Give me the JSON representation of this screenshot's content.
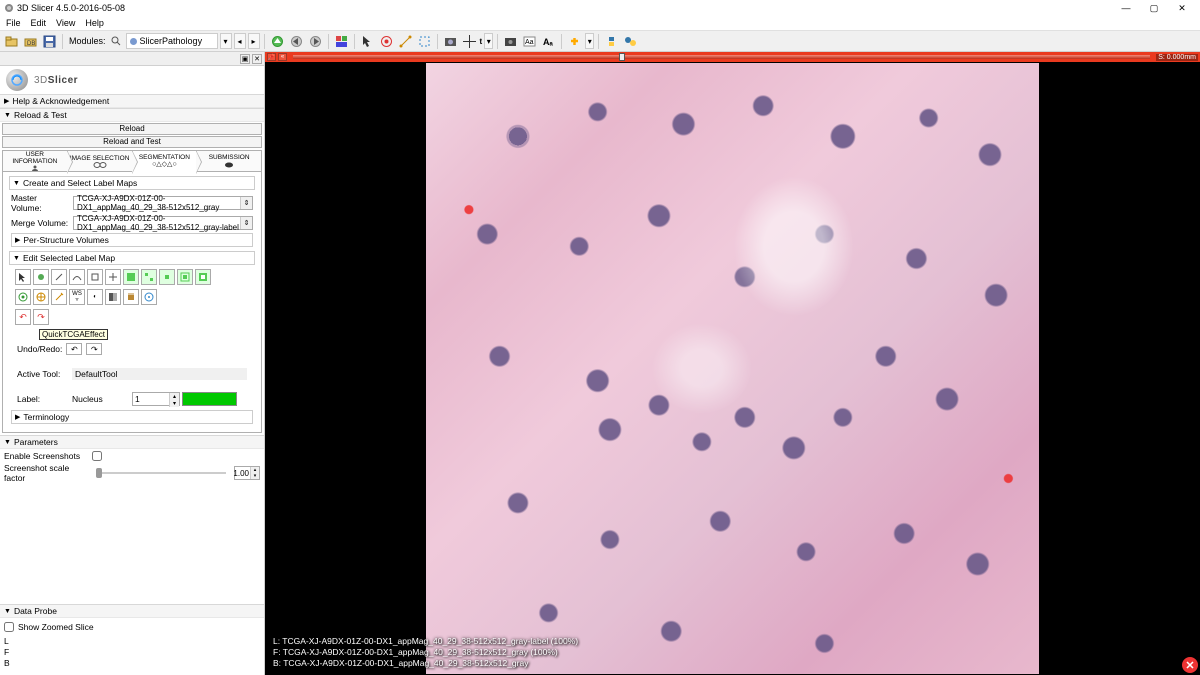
{
  "window": {
    "title": "3D Slicer 4.5.0-2016-05-08"
  },
  "menu": {
    "items": [
      "File",
      "Edit",
      "View",
      "Help"
    ]
  },
  "modules": {
    "label": "Modules:",
    "current": "SlicerPathology"
  },
  "logo": {
    "prefix": "3D",
    "suffix": "Slicer"
  },
  "sections": {
    "help": "Help & Acknowledgement",
    "reload": "Reload & Test",
    "reload_btn": "Reload",
    "reload_test_btn": "Reload and Test"
  },
  "tabs": {
    "items": [
      "USER INFORMATION",
      "IMAGE SELECTION",
      "SEGMENTATION",
      "SUBMISSION"
    ],
    "active": 2
  },
  "createSelect": {
    "title": "Create and Select Label Maps",
    "master_label": "Master Volume:",
    "master_value": "TCGA-XJ-A9DX-01Z-00-DX1_appMag_40_29_38-512x512_gray",
    "merge_label": "Merge Volume:",
    "merge_value": "TCGA-XJ-A9DX-01Z-00-DX1_appMag_40_29_38-512x512_gray-label",
    "per_structure": "Per-Structure Volumes"
  },
  "editMap": {
    "title": "Edit Selected Label Map",
    "tooltip": "QuickTCGAEffect",
    "undo_label": "Undo/Redo:",
    "active_tool_label": "Active Tool:",
    "active_tool_value": "DefaultTool",
    "label_label": "Label:",
    "label_name": "Nucleus",
    "label_value": "1",
    "terminology": "Terminology"
  },
  "params": {
    "title": "Parameters",
    "screenshot_label": "Enable Screenshots",
    "scale_label": "Screenshot scale factor",
    "scale_value": "1.00"
  },
  "dataprobe": {
    "title": "Data Probe",
    "zoomed": "Show Zoomed Slice",
    "lines": [
      "L",
      "F",
      "B"
    ]
  },
  "viewer": {
    "readout": "S: 0.000mm",
    "overlay": {
      "L": "L: TCGA-XJ-A9DX-01Z-00-DX1_appMag_40_29_38-512x512_gray-label (100%)",
      "F": "F: TCGA-XJ-A9DX-01Z-00-DX1_appMag_40_29_38-512x512_gray (100%)",
      "B": "B: TCGA-XJ-A9DX-01Z-00-DX1_appMag_40_29_38-512x512_gray"
    }
  }
}
